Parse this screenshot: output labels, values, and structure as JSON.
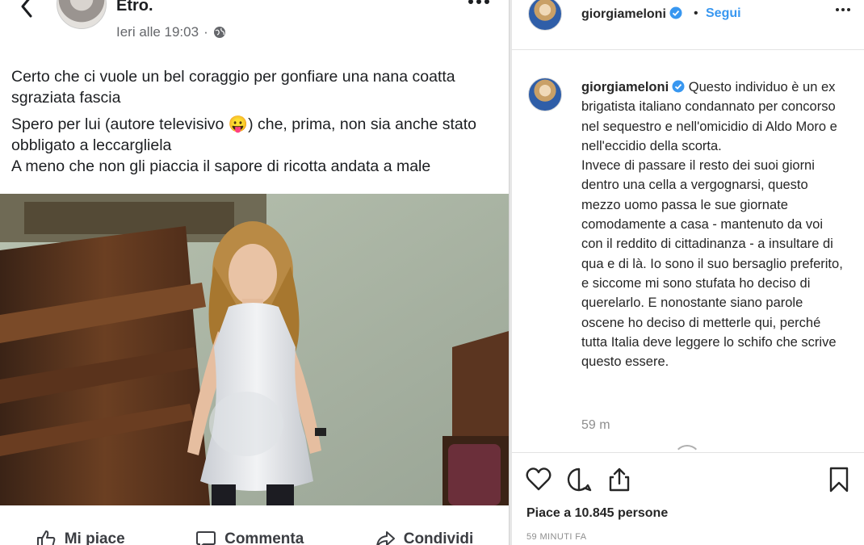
{
  "facebook": {
    "author_name": "Etro.",
    "timestamp": "Ieri alle 19:03",
    "post_lines": [
      "Certo che ci vuole un bel coraggio per gonfiare una nana coatta sgraziata fascia",
      "Spero per lui (autore televisivo 😛) che, prima, non sia anche stato obbligato a leccargliela",
      "A meno che non gli piaccia il sapore di ricotta andata a male"
    ],
    "actions": {
      "like_label": "Mi piace",
      "comment_label": "Commenta",
      "share_label": "Condividi"
    },
    "icons": [
      "back-arrow-icon",
      "more-icon",
      "globe-icon",
      "thumbs-up-icon",
      "comment-icon",
      "share-icon"
    ]
  },
  "instagram": {
    "header": {
      "username": "giorgiameloni",
      "dot": "•",
      "follow_label": "Segui"
    },
    "caption": {
      "username": "giorgiameloni",
      "text": " Questo individuo è un ex brigatista italiano condannato per concorso nel sequestro e nell'omicidio di Aldo Moro e nell'eccidio della scorta.",
      "text2": "Invece di passare il resto dei suoi giorni dentro una cella a vergognarsi, questo mezzo uomo passa le sue giornate comodamente a casa - mantenuto da voi con il reddito di cittadinanza - a insultare di qua e di là. Io sono il suo bersaglio preferito, e siccome mi sono stufata ho deciso di querelarlo. E nonostante siano parole oscene ho deciso di metterle qui, perché tutta Italia deve leggere lo schifo che scrive questo essere.",
      "relative_time": "59 m"
    },
    "likes": "Piace a 10.845 persone",
    "time_ago": "59 MINUTI FA",
    "icons": [
      "heart-icon",
      "comment-bubble-icon",
      "share-upload-icon",
      "bookmark-icon",
      "verified-badge-icon"
    ],
    "colors": {
      "link": "#3897f0",
      "verified": "#3897f0",
      "muted": "#8e8e8e"
    }
  }
}
